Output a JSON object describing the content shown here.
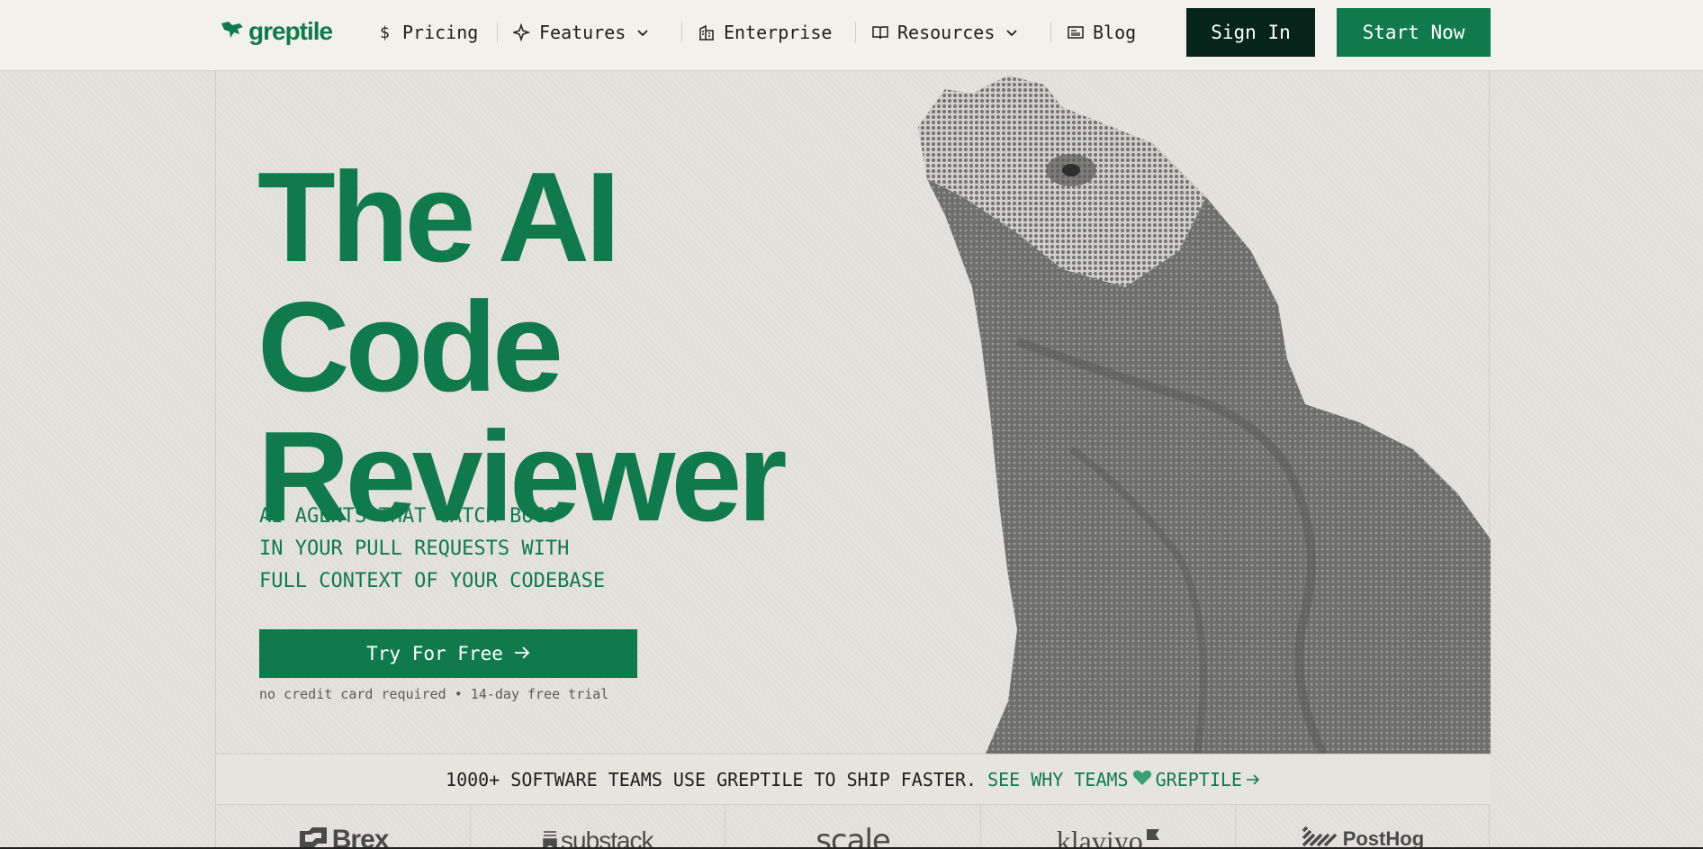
{
  "nav": {
    "logo_text": "greptile",
    "items": [
      {
        "label": "Pricing",
        "icon": "dollar-icon"
      },
      {
        "label": "Features",
        "icon": "sparkle-icon",
        "dropdown": true
      },
      {
        "label": "Enterprise",
        "icon": "building-icon"
      },
      {
        "label": "Resources",
        "icon": "book-icon",
        "dropdown": true
      },
      {
        "label": "Blog",
        "icon": "newspaper-icon"
      }
    ],
    "signin_label": "Sign In",
    "start_label": "Start Now"
  },
  "hero": {
    "title_line1": "The AI Code",
    "title_line2": "Reviewer",
    "sub_line1": "AI AGENTS THAT CATCH BUGS",
    "sub_line2": "IN YOUR PULL REQUESTS WITH",
    "sub_line3": "FULL CONTEXT OF YOUR CODEBASE",
    "cta_label": "Try For Free",
    "cta_note": "no credit card required • 14-day free trial"
  },
  "strip": {
    "text": "1000+ SOFTWARE TEAMS USE GREPTILE TO SHIP FASTER.",
    "link_pre": "SEE WHY TEAMS",
    "link_post": "GREPTILE"
  },
  "customers": [
    "Brex",
    "substack",
    "scale",
    "klaviyo",
    "PostHog"
  ],
  "colors": {
    "brand_green": "#117a4c",
    "dark_button": "#07241a",
    "background": "#e4e2dd"
  }
}
